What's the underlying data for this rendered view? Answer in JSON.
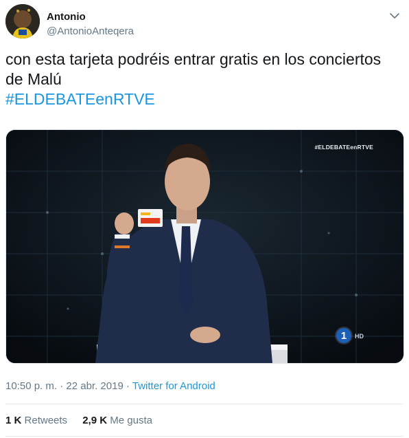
{
  "user": {
    "name": "Antonio",
    "handle": "@AntonioAnteqera"
  },
  "tweet": {
    "text": "con esta tarjeta podréis entrar gratis en los conciertos de Malú",
    "hashtag": "#ELDEBATEenRTVE"
  },
  "media": {
    "watermark": "#ELDEBATEenRTVE",
    "channel_number": "1",
    "channel_suffix": "HD"
  },
  "meta": {
    "time": "10:50 p. m.",
    "separator1": " · ",
    "date": "22 abr. 2019",
    "separator2": " · ",
    "source": "Twitter for Android"
  },
  "stats": {
    "retweets_count": "1 K",
    "retweets_label": "Retweets",
    "likes_count": "2,9 K",
    "likes_label": "Me gusta"
  },
  "colors": {
    "link": "#1b95e0",
    "muted": "#657786",
    "text": "#14171a"
  },
  "icons": {
    "caret": "chevron-down-icon"
  }
}
